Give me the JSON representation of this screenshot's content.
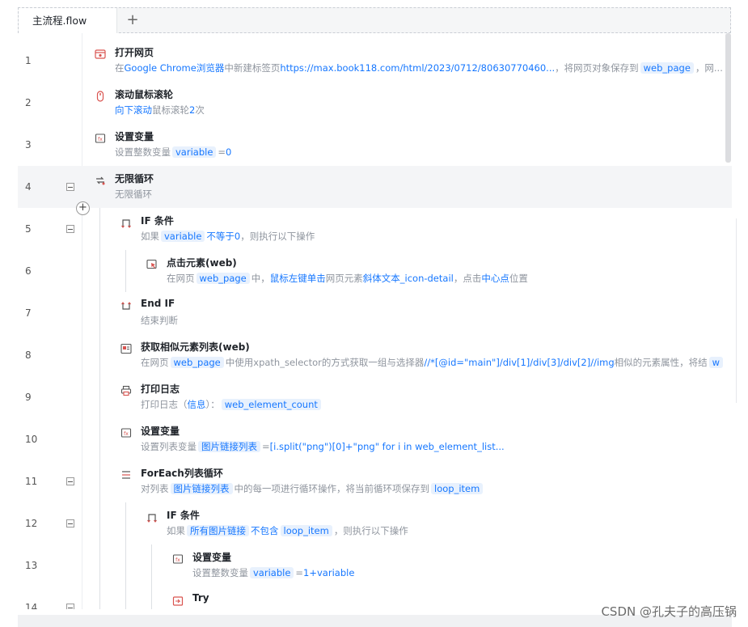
{
  "tab": {
    "label": "主流程.flow",
    "add_label": "+"
  },
  "add_step_label": "+",
  "rows": [
    {
      "num": "1",
      "title": "打开网页",
      "icon": "browser-icon",
      "desc": [
        "在",
        {
          "k": "Google Chrome浏览器"
        },
        "中新建标签页",
        {
          "k": "https://max.book118.com/html/2023/0712/80630770460..."
        },
        "，将网页对象保存到",
        {
          "c": "web_page"
        },
        "，网..."
      ]
    },
    {
      "num": "2",
      "title": "滚动鼠标滚轮",
      "icon": "mouse-wheel-icon",
      "desc": [
        {
          "k": "向下滚动"
        },
        "鼠标滚轮",
        {
          "k": "2"
        },
        "次"
      ]
    },
    {
      "num": "3",
      "title": "设置变量",
      "icon": "variable-icon",
      "desc": [
        "设置整数变量",
        {
          "c": "variable"
        },
        "=",
        {
          "k": "0"
        }
      ]
    },
    {
      "num": "4",
      "title": "无限循环",
      "icon": "loop-icon",
      "collapse": true,
      "highlight": true,
      "desc": [
        "无限循环"
      ]
    },
    {
      "num": "5",
      "title": "IF 条件",
      "icon": "if-icon",
      "collapse": true,
      "desc": [
        "如果",
        {
          "c": "variable"
        },
        {
          "k": "不等于"
        },
        {
          "k": "0"
        },
        "，则执行以下操作"
      ]
    },
    {
      "num": "6",
      "title": "点击元素(web)",
      "icon": "click-icon",
      "desc": [
        "在网页",
        {
          "c": "web_page"
        },
        "中，",
        {
          "k": "鼠标左键单击"
        },
        "网页元素",
        {
          "k": "斜体文本_icon-detail"
        },
        "，点击",
        {
          "k": "中心点"
        },
        "位置"
      ]
    },
    {
      "num": "7",
      "title": "End IF",
      "icon": "end-if-icon",
      "desc": [
        "结束判断"
      ]
    },
    {
      "num": "8",
      "title": "获取相似元素列表(web)",
      "icon": "element-list-icon",
      "desc": [
        "在网页",
        {
          "c": "web_page"
        },
        "中使用xpath_selector的方式获取一组与选择器",
        {
          "k": "//*[@id=\"main\"]/div[1]/div[3]/div[2]//img"
        },
        "相似的元素属性，将结",
        {
          "c": "w"
        }
      ]
    },
    {
      "num": "9",
      "title": "打印日志",
      "icon": "print-icon",
      "desc": [
        "打印日志（",
        {
          "k": "信息"
        },
        "）：",
        {
          "c": "web_element_count"
        }
      ]
    },
    {
      "num": "10",
      "title": "设置变量",
      "icon": "variable-icon",
      "desc": [
        "设置列表变量",
        {
          "c": "图片链接列表"
        },
        "=",
        {
          "k": "[i.split(\"png\")[0]+\"png\" for i in web_element_list..."
        }
      ]
    },
    {
      "num": "11",
      "title": "ForEach列表循环",
      "icon": "foreach-icon",
      "collapse": true,
      "desc": [
        "对列表",
        {
          "c": "图片链接列表"
        },
        "中的每一项进行循环操作，将当前循环项保存到",
        {
          "c": "loop_item"
        }
      ]
    },
    {
      "num": "12",
      "title": "IF 条件",
      "icon": "if-icon",
      "collapse": true,
      "desc": [
        "如果",
        {
          "c": "所有图片链接"
        },
        {
          "k": "不包含"
        },
        {
          "c": "loop_item"
        },
        "，则执行以下操作"
      ]
    },
    {
      "num": "13",
      "title": "设置变量",
      "icon": "variable-icon",
      "desc": [
        "设置整数变量",
        {
          "c": "variable"
        },
        "=",
        {
          "k": "1+variable"
        }
      ]
    },
    {
      "num": "14",
      "title": "Try",
      "icon": "try-icon",
      "collapse": true,
      "desc": []
    }
  ],
  "watermark": "CSDN @孔夫子的高压锅",
  "colors": {
    "accent": "#1677ff",
    "chip_bg": "#e8f1fd",
    "icon_red": "#d9534f"
  }
}
